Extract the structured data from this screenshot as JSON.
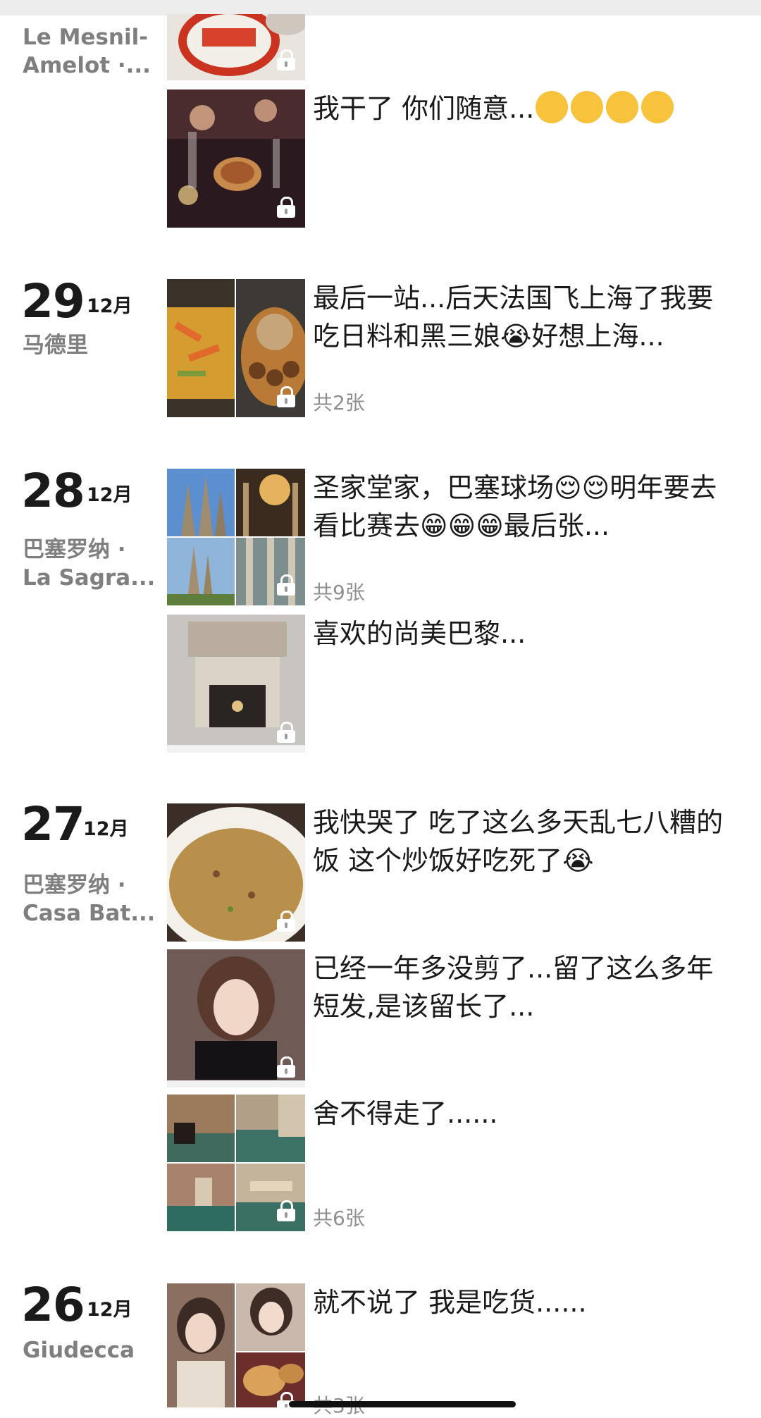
{
  "entries": [
    {
      "location": "Le Mesnil-\nAmelot ·...",
      "posts": [
        {
          "text": "我干了 你们随意...",
          "emojis": [
            "😌",
            "😌",
            "😌",
            "😌"
          ],
          "locked": true
        }
      ]
    },
    {
      "day": "29",
      "month": "12月",
      "location": "马德里",
      "posts": [
        {
          "text": "最后一站...后天法国飞上海了我要吃日料和黑三娘😭好想上海...",
          "count": "共2张",
          "locked": true
        }
      ]
    },
    {
      "day": "28",
      "month": "12月",
      "location": "巴塞罗纳 ·\nLa Sagra...",
      "posts": [
        {
          "text": "圣家堂家，巴塞球场😌😌明年要去看比赛去😁😁😁最后张...",
          "count": "共9张",
          "locked": true
        },
        {
          "text": "喜欢的尚美巴黎...",
          "locked": true
        }
      ]
    },
    {
      "day": "27",
      "month": "12月",
      "location": "巴塞罗纳 ·\nCasa Bat...",
      "posts": [
        {
          "text": "我快哭了 吃了这么多天乱七八糟的饭 这个炒饭好吃死了😭",
          "locked": true
        },
        {
          "text": "已经一年多没剪了...留了这么多年短发,是该留长了...",
          "locked": true
        },
        {
          "text": "舍不得走了......",
          "count": "共6张",
          "locked": true
        }
      ]
    },
    {
      "day": "26",
      "month": "12月",
      "location": "Giudecca",
      "posts": [
        {
          "text": "就不说了 我是吃货......",
          "count": "共3张",
          "locked": true
        }
      ]
    }
  ]
}
